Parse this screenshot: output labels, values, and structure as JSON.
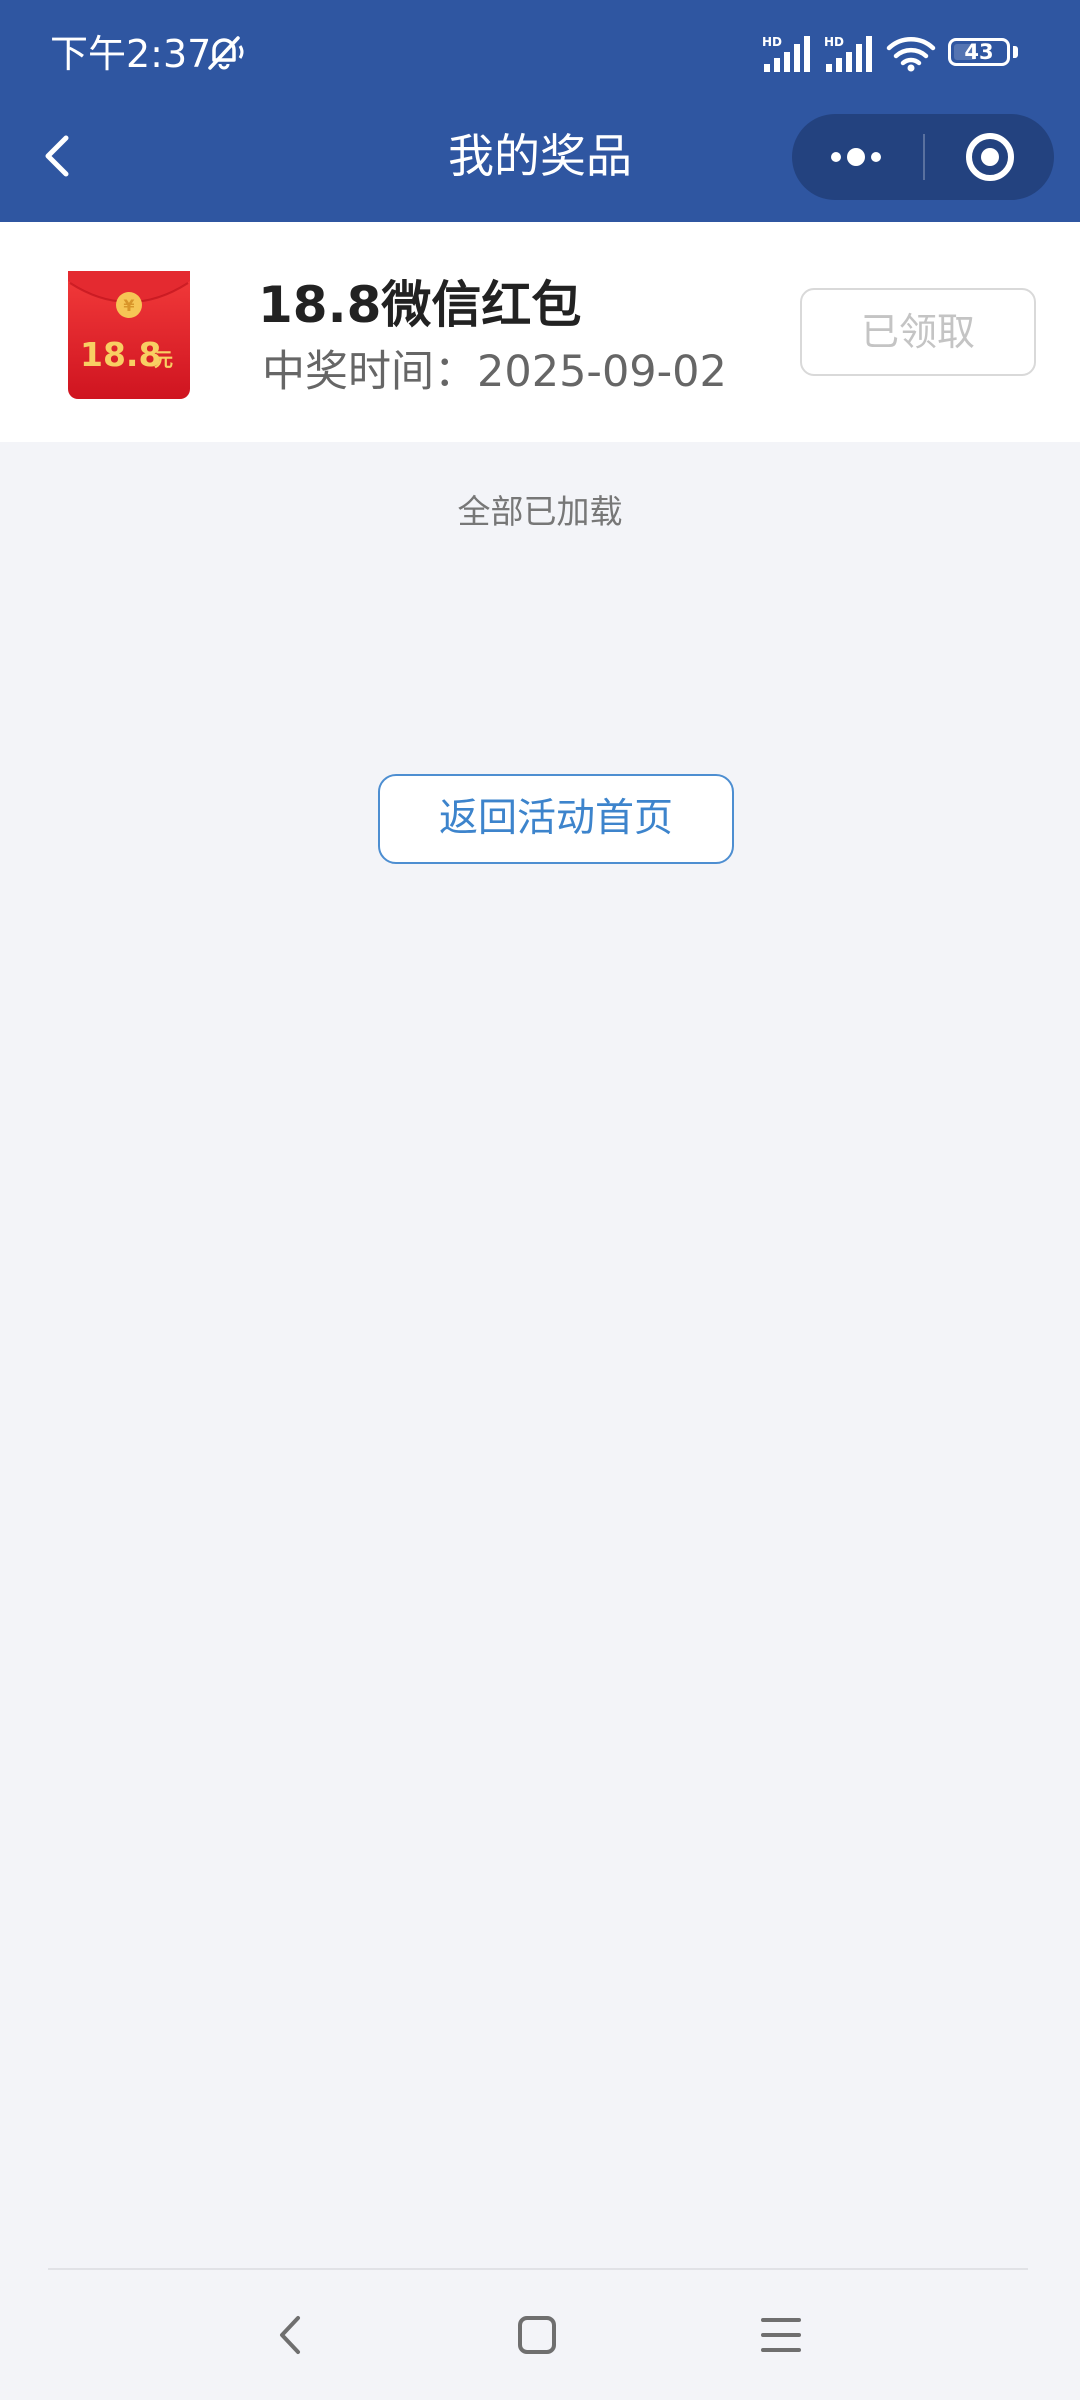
{
  "status_bar": {
    "time": "下午2:37",
    "battery": "43",
    "battery_level_percent": 43,
    "icons": [
      "mute-icon",
      "hd-signal-icon",
      "hd-signal-icon",
      "wifi-icon",
      "battery-icon"
    ]
  },
  "nav": {
    "title": "我的奖品",
    "back_icon": "back-arrow-icon",
    "more_icon": "more-dots-icon",
    "close_icon": "target-close-icon"
  },
  "prize": {
    "name": "18.8微信红包",
    "date": "中奖时间：2025-09-02",
    "amount": "18.8",
    "unit": "元",
    "status": "已领取"
  },
  "list": {
    "end_text": "全部已加载"
  },
  "actions": {
    "return_label": "返回活动首页"
  },
  "colors": {
    "header": "#2f56a1",
    "capsule": "#23427f",
    "page_bg": "#f3f4f8",
    "accent_blue": "#3d84cc",
    "red_packet": "#e0202a",
    "gold": "#f6c555"
  }
}
